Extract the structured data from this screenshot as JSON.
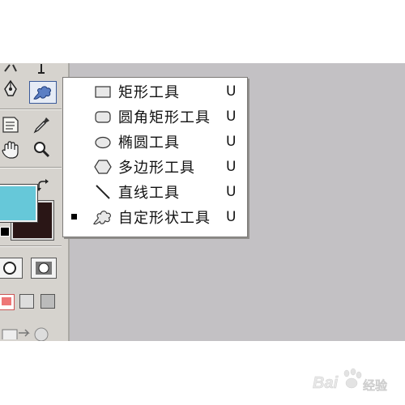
{
  "shape_menu": {
    "items": [
      {
        "label": "矩形工具",
        "shortcut": "U",
        "icon": "rectangle-icon",
        "selected": false
      },
      {
        "label": "圆角矩形工具",
        "shortcut": "U",
        "icon": "rounded-rectangle-icon",
        "selected": false
      },
      {
        "label": "椭圆工具",
        "shortcut": "U",
        "icon": "ellipse-icon",
        "selected": false
      },
      {
        "label": "多边形工具",
        "shortcut": "U",
        "icon": "polygon-icon",
        "selected": false
      },
      {
        "label": "直线工具",
        "shortcut": "U",
        "icon": "line-icon",
        "selected": false
      },
      {
        "label": "自定形状工具",
        "shortcut": "U",
        "icon": "custom-shape-icon",
        "selected": true
      }
    ]
  },
  "colors": {
    "foreground": "#66c8d9",
    "background": "#2a1616",
    "menu_background": "#ffffff",
    "canvas": "#c3c1c4",
    "toolbox": "#d6d3ce"
  },
  "watermark": {
    "text": "Baidu 经验"
  }
}
